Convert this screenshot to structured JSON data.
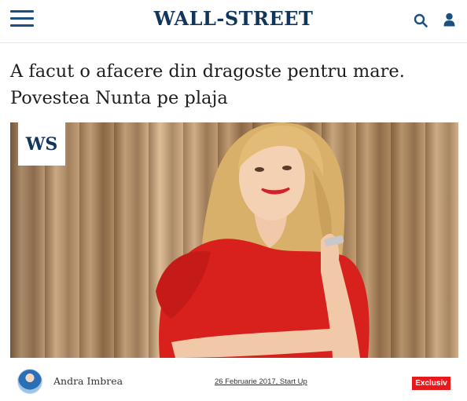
{
  "header": {
    "logo": "WALL-STREET",
    "menu_icon": "hamburger-menu-icon",
    "search_icon": "search-icon",
    "user_icon": "user-icon",
    "brand_color": "#12355b"
  },
  "article": {
    "title_line1": "A facut o afacere din dragoste pentru mare.",
    "title_line2": "Povestea Nunta pe plaja",
    "image_badge": "WS",
    "author": "Andra Imbrea",
    "date_category": "26 Februarie 2017, Start Up",
    "tag": "Exclusiv",
    "tag_color": "#e8191a"
  }
}
